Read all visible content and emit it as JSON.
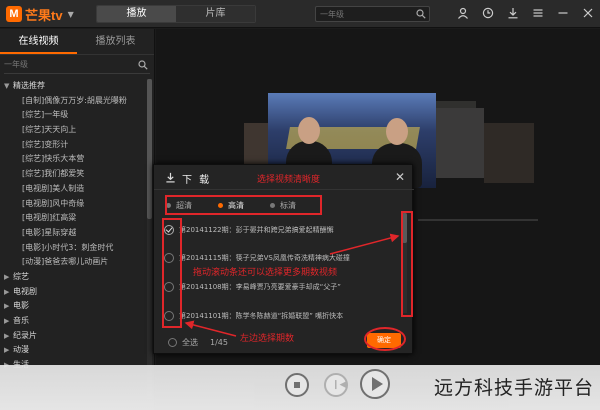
{
  "app": {
    "logo_mark": "M",
    "logo_text": "芒果tv",
    "tabs": [
      {
        "label": "播放",
        "active": true
      },
      {
        "label": "片库",
        "active": false
      }
    ],
    "search_placeholder": "一年级",
    "accent_color": "#ff6a00"
  },
  "sidebar": {
    "tabs": [
      {
        "label": "在线视频",
        "active": true
      },
      {
        "label": "播放列表",
        "active": false
      }
    ],
    "search_placeholder": "一年级",
    "items": [
      {
        "label": "精选推荐",
        "type": "group",
        "expanded": true
      },
      {
        "label": "[自制]偶像万万岁:胡晨光曝粉",
        "type": "child"
      },
      {
        "label": "[综艺]一年级",
        "type": "child"
      },
      {
        "label": "[综艺]天天向上",
        "type": "child"
      },
      {
        "label": "[综艺]变形计",
        "type": "child"
      },
      {
        "label": "[综艺]快乐大本营",
        "type": "child"
      },
      {
        "label": "[综艺]我们都爱笑",
        "type": "child"
      },
      {
        "label": "[电视剧]美人制造",
        "type": "child"
      },
      {
        "label": "[电视剧]风中奇缘",
        "type": "child"
      },
      {
        "label": "[电视剧]红高粱",
        "type": "child"
      },
      {
        "label": "[电影]星际穿越",
        "type": "child"
      },
      {
        "label": "[电影]小时代3：刺金时代",
        "type": "child"
      },
      {
        "label": "[动漫]爸爸去哪儿动画片",
        "type": "child"
      },
      {
        "label": "综艺",
        "type": "group",
        "expanded": false
      },
      {
        "label": "电视剧",
        "type": "group",
        "expanded": false
      },
      {
        "label": "电影",
        "type": "group",
        "expanded": false
      },
      {
        "label": "音乐",
        "type": "group",
        "expanded": false
      },
      {
        "label": "纪录片",
        "type": "group",
        "expanded": false
      },
      {
        "label": "动漫",
        "type": "group",
        "expanded": false
      },
      {
        "label": "生活",
        "type": "group",
        "expanded": false
      }
    ]
  },
  "dialog": {
    "title": "下 载",
    "quality_options": [
      {
        "label": "超清",
        "selected": false
      },
      {
        "label": "高清",
        "selected": true
      },
      {
        "label": "标清",
        "selected": false
      }
    ],
    "episodes": [
      {
        "label": "第20141122期：彭于晏并和跨兄弟搞爱起精酬懈",
        "checked": true
      },
      {
        "label": "第20141115期：筷子兄弟VS凤凰传奇洗精神病大碰撞",
        "checked": false
      },
      {
        "label": "第20141108期：李易峰贾乃亮要爱豪手却成“父子”",
        "checked": false
      },
      {
        "label": "第20141101期：陈学冬陈赫道“拆婚联盟” 嘴折快本",
        "checked": false
      }
    ],
    "select_all": "全选",
    "count": "1/45",
    "confirm": "确定"
  },
  "annotations": {
    "quality": "选择视频清晰度",
    "scroll": "拖动滚动条还可以选择更多期数视频",
    "select": "左边选择期数"
  },
  "watermark": "远方科技手游平台"
}
